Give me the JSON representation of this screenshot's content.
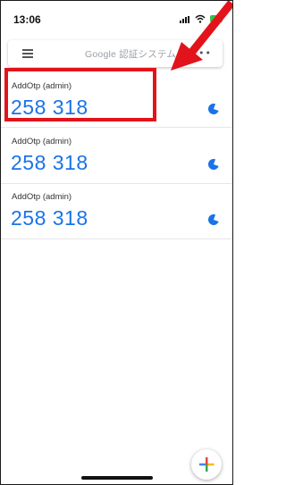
{
  "status": {
    "time": "13:06"
  },
  "app_bar": {
    "title": "Google 認証システム",
    "more": "•••"
  },
  "accounts": [
    {
      "label": "AddOtp (admin)",
      "code": "258 318"
    },
    {
      "label": "AddOtp (admin)",
      "code": "258 318"
    },
    {
      "label": "AddOtp (admin)",
      "code": "258 318"
    }
  ],
  "colors": {
    "code": "#1a73e8",
    "highlight": "#e2131b",
    "timer": "#1a73e8"
  },
  "icons": {
    "menu": "hamburger-menu-icon",
    "more": "more-horizontal-icon",
    "timer": "countdown-timer-icon",
    "add": "add-plus-icon"
  }
}
